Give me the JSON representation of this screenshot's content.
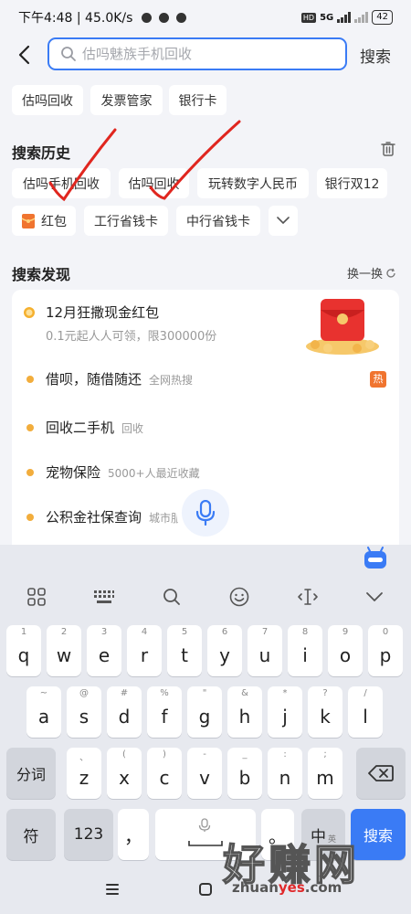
{
  "status": {
    "time_speed": "下午4:48 | 45.0K/s",
    "hd": "HD",
    "network": "5G",
    "battery": "42"
  },
  "search": {
    "placeholder": "估吗魅族手机回收",
    "button_label": "搜索"
  },
  "top_chips": [
    "估吗回收",
    "发票管家",
    "银行卡"
  ],
  "history": {
    "title": "搜索历史",
    "row1": [
      "估吗手机回收",
      "估吗回收",
      "玩转数字人民币",
      "银行双12"
    ],
    "row2": [
      "红包",
      "工行省钱卡",
      "中行省钱卡"
    ]
  },
  "discover": {
    "title": "搜索发现",
    "refresh_label": "换一换",
    "featured": {
      "title": "12月狂撒现金红包",
      "subtitle": "0.1元起人人可领，限300000份"
    },
    "items": [
      {
        "title": "借呗，随借随还",
        "tag": "全网热搜",
        "badge": "热"
      },
      {
        "title": "回收二手机",
        "tag": "回收",
        "badge": ""
      },
      {
        "title": "宠物保险",
        "tag": "5000+人最近收藏",
        "badge": ""
      },
      {
        "title": "公积金社保查询",
        "tag": "城市服",
        "badge": ""
      }
    ]
  },
  "keyboard": {
    "row1": [
      {
        "k": "q",
        "s": "1"
      },
      {
        "k": "w",
        "s": "2"
      },
      {
        "k": "e",
        "s": "3"
      },
      {
        "k": "r",
        "s": "4"
      },
      {
        "k": "t",
        "s": "5"
      },
      {
        "k": "y",
        "s": "6"
      },
      {
        "k": "u",
        "s": "7"
      },
      {
        "k": "i",
        "s": "8"
      },
      {
        "k": "o",
        "s": "9"
      },
      {
        "k": "p",
        "s": "0"
      }
    ],
    "row2": [
      {
        "k": "a",
        "s": "~"
      },
      {
        "k": "s",
        "s": "@"
      },
      {
        "k": "d",
        "s": "#"
      },
      {
        "k": "f",
        "s": "%"
      },
      {
        "k": "g",
        "s": "\""
      },
      {
        "k": "h",
        "s": "&"
      },
      {
        "k": "j",
        "s": "*"
      },
      {
        "k": "k",
        "s": "?"
      },
      {
        "k": "l",
        "s": "/"
      }
    ],
    "row3": [
      {
        "k": "z",
        "s": "、"
      },
      {
        "k": "x",
        "s": "("
      },
      {
        "k": "c",
        "s": ")"
      },
      {
        "k": "v",
        "s": "-"
      },
      {
        "k": "b",
        "s": "_"
      },
      {
        "k": "n",
        "s": ":"
      },
      {
        "k": "m",
        "s": ";"
      }
    ],
    "fenci": "分词",
    "fu": "符",
    "num": "123",
    "comma": "，",
    "period": "。",
    "zh": "中",
    "zh_sub": "英",
    "go": "搜索"
  },
  "watermark": {
    "text": "好赚网",
    "url_pre": "zhuan",
    "url_mid": "yes",
    "url_post": ".com"
  }
}
